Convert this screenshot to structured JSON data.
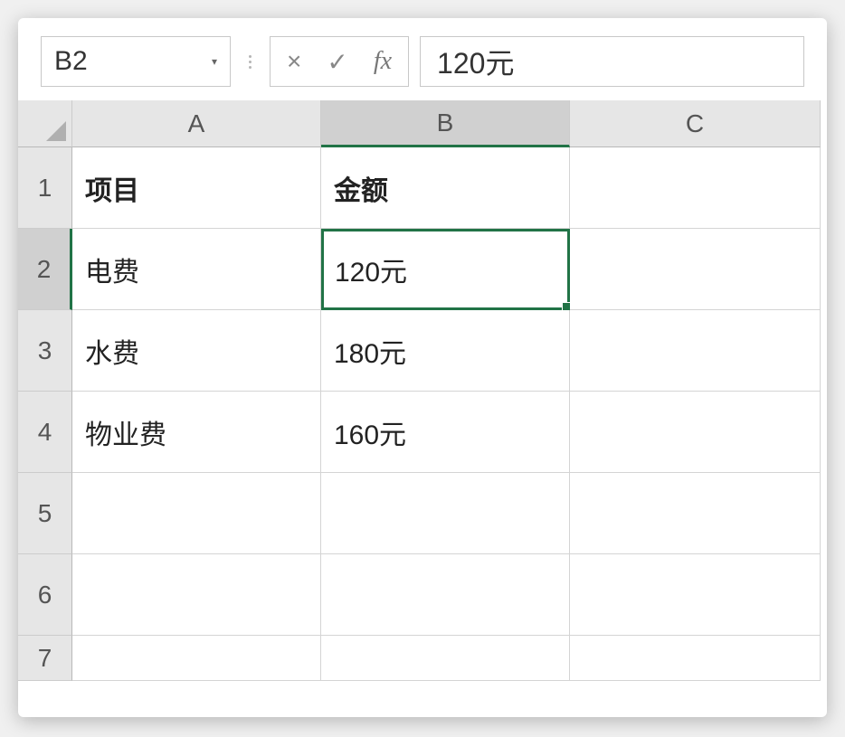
{
  "formula_bar": {
    "name_box": "B2",
    "cancel_symbol": "×",
    "enter_symbol": "✓",
    "fx_symbol": "fx",
    "formula_value": "120元"
  },
  "columns": [
    "A",
    "B",
    "C"
  ],
  "rows": [
    "1",
    "2",
    "3",
    "4",
    "5",
    "6",
    "7"
  ],
  "active_cell": "B2",
  "active_column_index": 1,
  "active_row_index": 1,
  "cells": {
    "A1": "项目",
    "B1": "金额",
    "A2": "电费",
    "B2": "120元",
    "A3": "水费",
    "B3": "180元",
    "A4": "物业费",
    "B4": "160元"
  }
}
